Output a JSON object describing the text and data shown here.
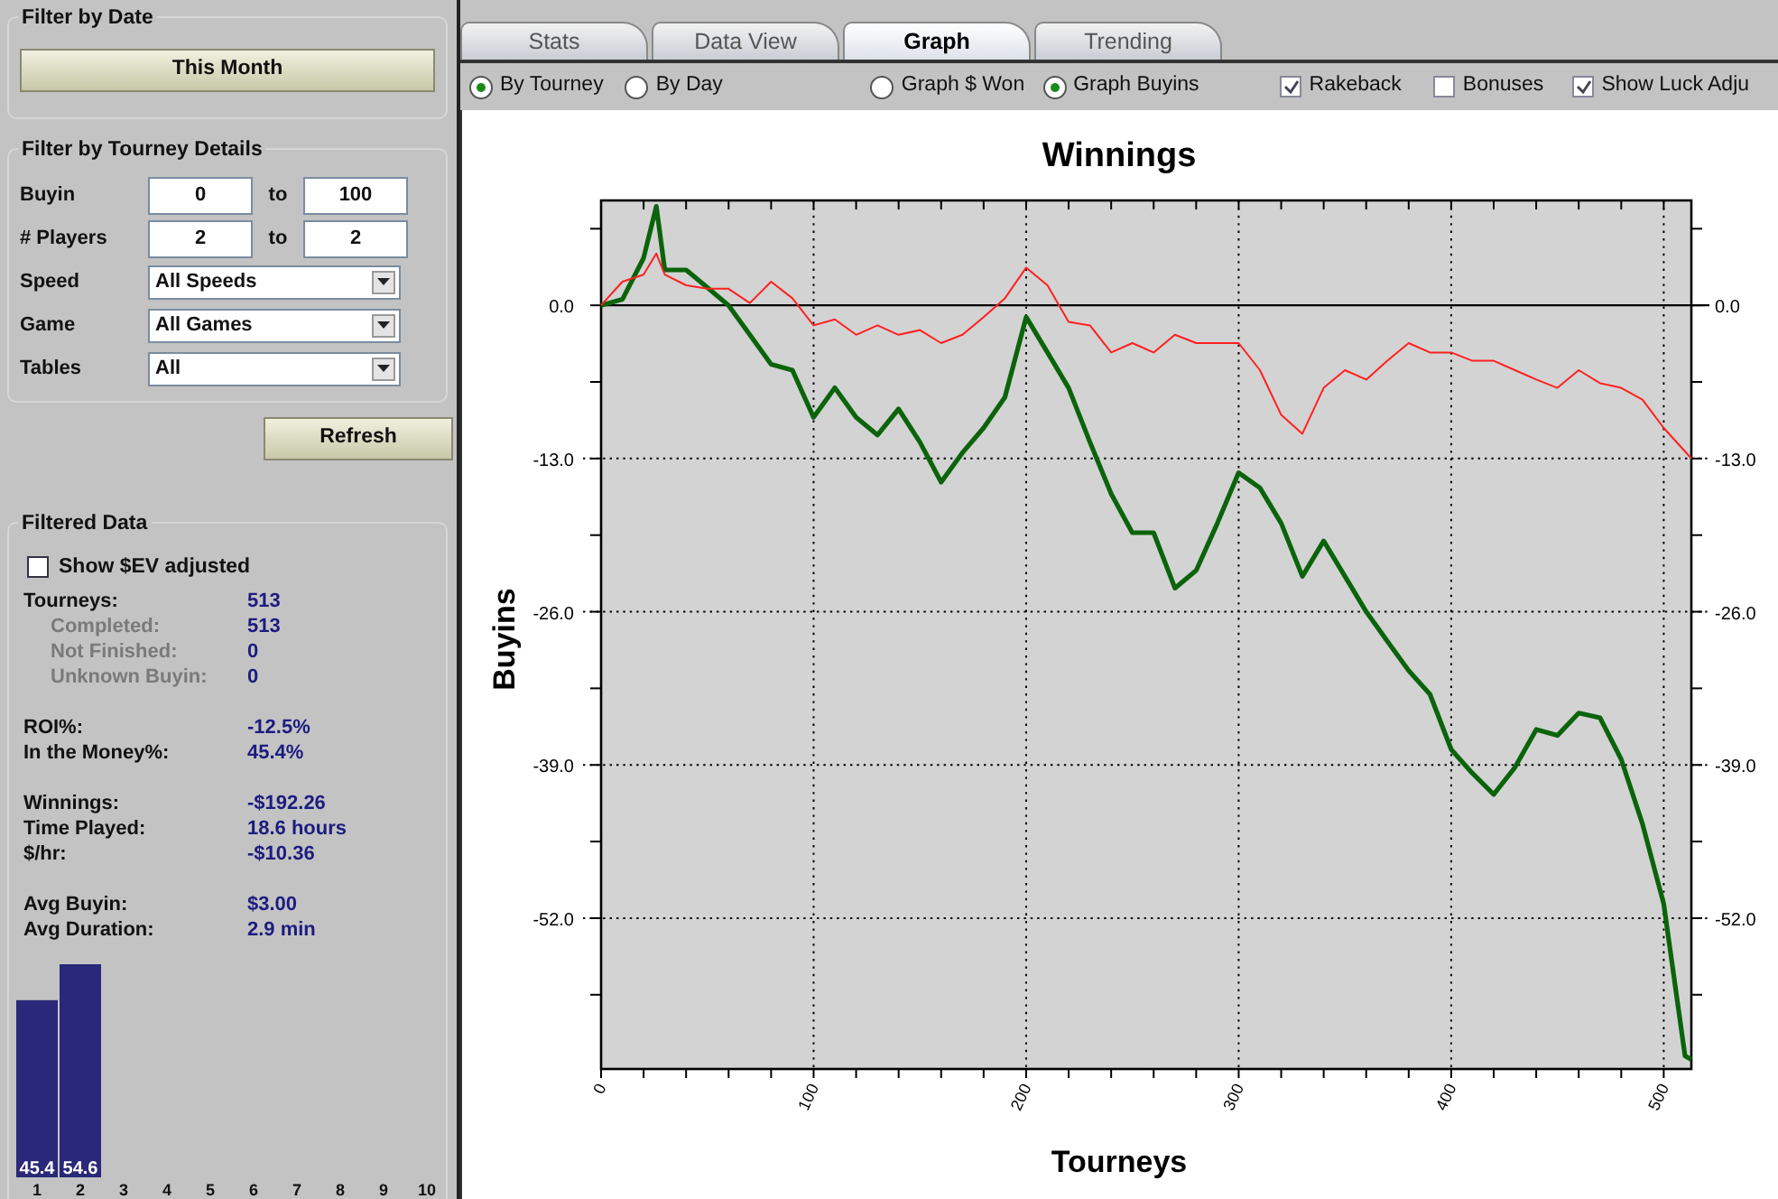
{
  "filter_by_date": {
    "title": "Filter by Date",
    "button": "This Month"
  },
  "filter_by_tourney": {
    "title": "Filter by Tourney Details",
    "ranges": [
      {
        "label": "Buyin",
        "from": "0",
        "joiner": "to",
        "to": "100"
      },
      {
        "label": "# Players",
        "from": "2",
        "joiner": "to",
        "to": "2"
      }
    ],
    "dropdowns": [
      {
        "label": "Speed",
        "value": "All Speeds"
      },
      {
        "label": "Game",
        "value": "All Games"
      },
      {
        "label": "Tables",
        "value": "All"
      }
    ]
  },
  "refresh_button": "Refresh",
  "filtered_data": {
    "title": "Filtered Data",
    "ev_checkbox": {
      "label": "Show $EV adjusted",
      "checked": false
    },
    "groups": [
      [
        {
          "label": "Tourneys:",
          "value": "513",
          "sub": false
        },
        {
          "label": "Completed:",
          "value": "513",
          "sub": true
        },
        {
          "label": "Not Finished:",
          "value": "0",
          "sub": true
        },
        {
          "label": "Unknown Buyin:",
          "value": "0",
          "sub": true
        }
      ],
      [
        {
          "label": "ROI%:",
          "value": "-12.5%",
          "sub": false
        },
        {
          "label": "In the Money%:",
          "value": "45.4%",
          "sub": false
        }
      ],
      [
        {
          "label": "Winnings:",
          "value": "-$192.26",
          "sub": false
        },
        {
          "label": "Time Played:",
          "value": "18.6 hours",
          "sub": false
        },
        {
          "label": "$/hr:",
          "value": "-$10.36",
          "sub": false
        }
      ],
      [
        {
          "label": "Avg Buyin:",
          "value": "$3.00",
          "sub": false
        },
        {
          "label": "Avg Duration:",
          "value": "2.9 min",
          "sub": false
        }
      ]
    ],
    "histogram": {
      "chart_data": {
        "type": "bar",
        "categories": [
          "1",
          "2",
          "3",
          "4",
          "5",
          "6",
          "7",
          "8",
          "9",
          "10"
        ],
        "values": [
          45.4,
          54.6,
          null,
          null,
          null,
          null,
          null,
          null,
          null,
          null
        ],
        "data_labels": true
      }
    }
  },
  "tabs": [
    {
      "label": "Stats",
      "selected": false
    },
    {
      "label": "Data View",
      "selected": false
    },
    {
      "label": "Graph",
      "selected": true
    },
    {
      "label": "Trending",
      "selected": false
    }
  ],
  "graph_options": [
    {
      "kind": "radio",
      "label": "By Tourney",
      "selected": true
    },
    {
      "kind": "radio",
      "label": "By Day",
      "selected": false
    },
    {
      "kind": "radio",
      "label": "Graph $ Won",
      "selected": false
    },
    {
      "kind": "radio",
      "label": "Graph Buyins",
      "selected": true
    },
    {
      "kind": "checkbox",
      "label": "Rakeback",
      "checked": true
    },
    {
      "kind": "checkbox",
      "label": "Bonuses",
      "checked": false
    },
    {
      "kind": "checkbox",
      "label": "Show Luck Adju",
      "checked": true
    }
  ],
  "graph": {
    "chart_data": {
      "type": "line",
      "title": "Winnings",
      "xlabel": "Tourneys",
      "ylabel": "Buyins",
      "x": [
        0,
        10,
        20,
        26,
        30,
        40,
        50,
        60,
        70,
        80,
        90,
        100,
        110,
        120,
        130,
        140,
        150,
        160,
        170,
        180,
        190,
        200,
        210,
        220,
        230,
        240,
        250,
        260,
        270,
        280,
        290,
        300,
        310,
        320,
        330,
        340,
        350,
        360,
        370,
        380,
        390,
        400,
        410,
        420,
        430,
        440,
        450,
        460,
        470,
        480,
        490,
        500,
        510,
        513
      ],
      "series": [
        {
          "color": "#0b640b",
          "values": [
            0,
            0.5,
            4,
            8.4,
            3,
            3,
            1.5,
            0,
            -2.5,
            -5,
            -5.5,
            -9.5,
            -7,
            -9.5,
            -11,
            -8.8,
            -11.6,
            -15,
            -12.5,
            -10.4,
            -7.8,
            -1,
            -4,
            -7,
            -11.6,
            -16,
            -19.3,
            -19.3,
            -24,
            -22.5,
            -18.5,
            -14.2,
            -15.5,
            -18.5,
            -23,
            -20,
            -23,
            -26,
            -28.5,
            -31,
            -33,
            -37.7,
            -39.7,
            -41.5,
            -39.2,
            -36,
            -36.5,
            -34.6,
            -35,
            -38.5,
            -44,
            -50.8,
            -63.7,
            -64
          ]
        },
        {
          "color": "#ff2020",
          "values": [
            0,
            2,
            2.6,
            4.4,
            2.6,
            1.7,
            1.4,
            1.4,
            0.2,
            2,
            0.6,
            -1.7,
            -1.2,
            -2.5,
            -1.7,
            -2.5,
            -2.1,
            -3.2,
            -2.5,
            -1,
            0.6,
            3.2,
            1.7,
            -1.4,
            -1.7,
            -4,
            -3.2,
            -4,
            -2.5,
            -3.2,
            -3.2,
            -3.2,
            -5.5,
            -9.3,
            -10.9,
            -7,
            -5.5,
            -6.3,
            -4.7,
            -3.2,
            -4,
            -4,
            -4.7,
            -4.7,
            -5.5,
            -6.3,
            -7,
            -5.5,
            -6.6,
            -7,
            -8,
            -10.4,
            -12.4,
            -13
          ]
        }
      ],
      "grid": true,
      "xlim": [
        0,
        513
      ],
      "ylim": [
        -64.8,
        8.9
      ],
      "xticks": [
        0,
        100,
        200,
        300,
        400,
        500
      ],
      "yticks": [
        {
          "value": 0,
          "label": "0.0"
        },
        {
          "value": -13,
          "label": "-13.0"
        },
        {
          "value": -26,
          "label": "-26.0"
        },
        {
          "value": -39,
          "label": "-39.0"
        },
        {
          "value": -52,
          "label": "-52.0"
        }
      ]
    }
  }
}
